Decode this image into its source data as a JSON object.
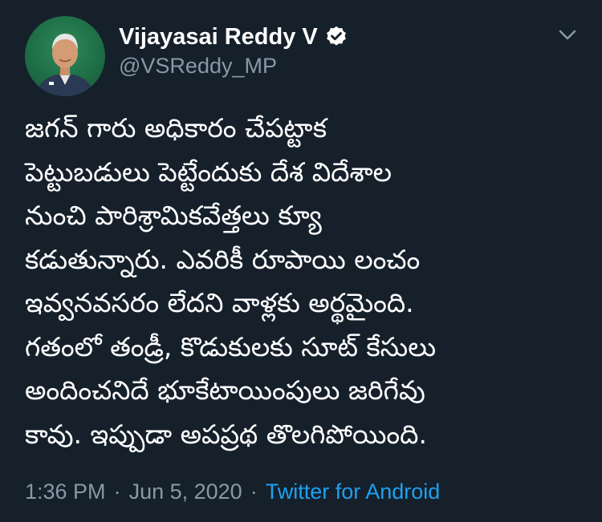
{
  "author": {
    "display_name": "Vijayasai Reddy V",
    "handle": "@VSReddy_MP",
    "verified": true
  },
  "tweet": {
    "text": "జగన్ గారు అధికారం చేపట్టాక\nపెట్టుబడులు పెట్టేందుకు దేశ విదేశాల\nనుంచి పారిశ్రామికవేత్తలు క్యూ\nకడుతున్నారు. ఎవరికీ రూపాయి లంచం\nఇవ్వనవసరం లేదని వాళ్లకు అర్థమైంది.\nగతంలో తండ్రీ, కొడుకులకు సూట్ కేసులు\nఅందించనిదే భూకేటాయింపులు జరిగేవు\nకావు. ఇప్పుడా అపప్రథ తొలగిపోయింది.",
    "time": "1:36 PM",
    "separator_1": "·",
    "date": "Jun 5, 2020",
    "separator_2": "·",
    "source": "Twitter for Android"
  },
  "icons": {
    "verified": "verified-badge-icon",
    "caret": "chevron-down-icon"
  },
  "colors": {
    "background": "#15202b",
    "primary_text": "#ffffff",
    "secondary_text": "#8899a6",
    "link": "#1da1f2"
  }
}
